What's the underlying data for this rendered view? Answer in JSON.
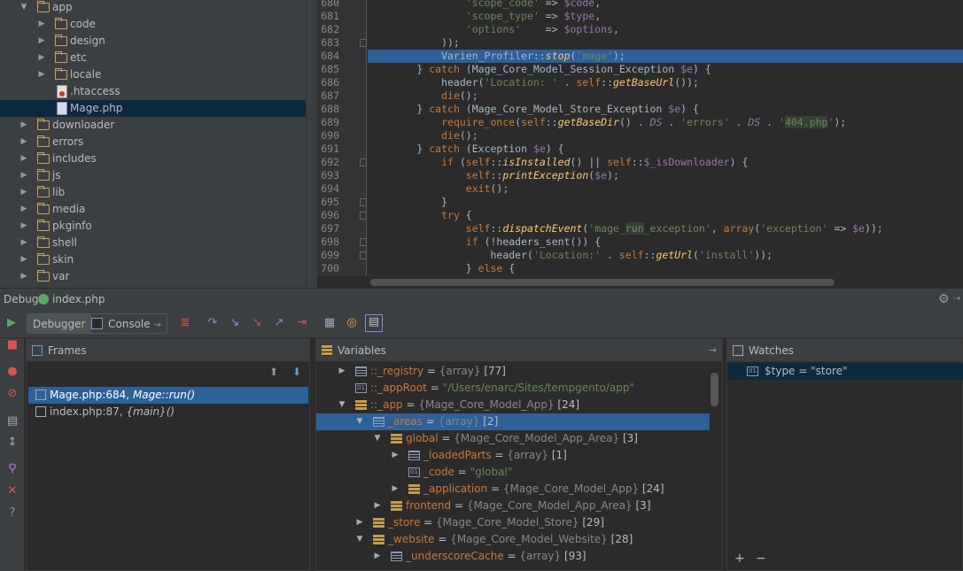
{
  "tree": {
    "items": [
      {
        "label": "app",
        "icon": "folder-icon",
        "expanded": true
      },
      {
        "label": "code",
        "icon": "folder-icon",
        "expanded": false
      },
      {
        "label": "design",
        "icon": "folder-icon",
        "expanded": false
      },
      {
        "label": "etc",
        "icon": "folder-icon",
        "expanded": false
      },
      {
        "label": "locale",
        "icon": "folder-icon",
        "expanded": false
      },
      {
        "label": ".htaccess",
        "icon": "file-icon"
      },
      {
        "label": "Mage.php",
        "icon": "php-file-icon",
        "selected": true
      },
      {
        "label": "downloader",
        "icon": "folder-icon",
        "expanded": false
      },
      {
        "label": "errors",
        "icon": "folder-icon",
        "expanded": false
      },
      {
        "label": "includes",
        "icon": "folder-icon",
        "expanded": false
      },
      {
        "label": "js",
        "icon": "folder-icon",
        "expanded": false
      },
      {
        "label": "lib",
        "icon": "folder-icon",
        "expanded": false
      },
      {
        "label": "media",
        "icon": "folder-icon",
        "expanded": false
      },
      {
        "label": "pkginfo",
        "icon": "folder-icon",
        "expanded": false
      },
      {
        "label": "shell",
        "icon": "folder-icon",
        "expanded": false
      },
      {
        "label": "skin",
        "icon": "folder-icon",
        "expanded": false
      },
      {
        "label": "var",
        "icon": "folder-icon",
        "expanded": false
      }
    ]
  },
  "editor": {
    "lines": [
      {
        "n": "680",
        "t": "                'scope_code' => $code,"
      },
      {
        "n": "681",
        "t": "                'scope_type' => $type,"
      },
      {
        "n": "682",
        "t": "                'options'    => $options,"
      },
      {
        "n": "683",
        "t": "            ));"
      },
      {
        "n": "684",
        "t": "            Varien_Profiler::stop('mage');",
        "highlight": true
      },
      {
        "n": "685",
        "t": "        } catch (Mage_Core_Model_Session_Exception $e) {"
      },
      {
        "n": "686",
        "t": "            header('Location: ' . self::getBaseUrl());"
      },
      {
        "n": "687",
        "t": "            die();"
      },
      {
        "n": "688",
        "t": "        } catch (Mage_Core_Model_Store_Exception $e) {"
      },
      {
        "n": "689",
        "t": "            require_once(self::getBaseDir() . DS . 'errors' . DS . '404.php');"
      },
      {
        "n": "690",
        "t": "            die();"
      },
      {
        "n": "691",
        "t": "        } catch (Exception $e) {"
      },
      {
        "n": "692",
        "t": "            if (self::isInstalled() || self::$_isDownloader) {"
      },
      {
        "n": "693",
        "t": "                self::printException($e);"
      },
      {
        "n": "694",
        "t": "                exit();"
      },
      {
        "n": "695",
        "t": "            }"
      },
      {
        "n": "696",
        "t": "            try {"
      },
      {
        "n": "697",
        "t": "                self::dispatchEvent('mage_run_exception', array('exception' => $e));"
      },
      {
        "n": "698",
        "t": "                if (!headers_sent()) {"
      },
      {
        "n": "699",
        "t": "                    header('Location:' . self::getUrl('install'));"
      },
      {
        "n": "700",
        "t": "                } else {"
      }
    ]
  },
  "debug": {
    "title": "Debug",
    "config": "index.php",
    "tabs": [
      {
        "label": "Debugger"
      },
      {
        "label": "Console"
      }
    ],
    "frames_title": "Frames",
    "frames": [
      {
        "file": "Mage.php:684, ",
        "fn": "Mage::run()",
        "selected": true
      },
      {
        "file": "index.php:87, ",
        "fn": "{main}()"
      }
    ],
    "variables_title": "Variables",
    "variables": [
      {
        "level": 0,
        "arrow": "right",
        "icon": "array",
        "name": "::_registry",
        "eq": " = ",
        "type": "{array}",
        "extra": " [77]"
      },
      {
        "level": 0,
        "arrow": "",
        "icon": "string",
        "name": "::_appRoot",
        "eq": " = ",
        "str": "\"/Users/enarc/Sites/tempgento/app\""
      },
      {
        "level": 0,
        "arrow": "down",
        "icon": "object",
        "name": "::_app",
        "eq": " = ",
        "type": "{Mage_Core_Model_App}",
        "extra": " [24]"
      },
      {
        "level": 1,
        "arrow": "down",
        "icon": "array",
        "name": "_areas",
        "eq": " = ",
        "type": "{array}",
        "extra": " [2]",
        "selected": true
      },
      {
        "level": 2,
        "arrow": "down",
        "icon": "object",
        "name": "global",
        "eq": " = ",
        "type": "{Mage_Core_Model_App_Area}",
        "extra": " [3]"
      },
      {
        "level": 3,
        "arrow": "right",
        "icon": "array",
        "name": "_loadedParts",
        "eq": " = ",
        "type": "{array}",
        "extra": " [1]"
      },
      {
        "level": 3,
        "arrow": "",
        "icon": "string",
        "name": "_code",
        "eq": " = ",
        "str": "\"global\""
      },
      {
        "level": 3,
        "arrow": "right",
        "icon": "object",
        "name": "_application",
        "eq": " = ",
        "type": "{Mage_Core_Model_App}",
        "extra": " [24]"
      },
      {
        "level": 2,
        "arrow": "right",
        "icon": "object",
        "name": "frontend",
        "eq": " = ",
        "type": "{Mage_Core_Model_App_Area}",
        "extra": " [3]"
      },
      {
        "level": 1,
        "arrow": "right",
        "icon": "object",
        "name": "_store",
        "eq": " = ",
        "type": "{Mage_Core_Model_Store}",
        "extra": " [29]"
      },
      {
        "level": 1,
        "arrow": "down",
        "icon": "object",
        "name": "_website",
        "eq": " = ",
        "type": "{Mage_Core_Model_Website}",
        "extra": " [28]"
      },
      {
        "level": 2,
        "arrow": "right",
        "icon": "array",
        "name": "_underscoreCache",
        "eq": " = ",
        "type": "{array}",
        "extra": " [93]"
      }
    ],
    "watches_title": "Watches",
    "watches": [
      {
        "text": "$type = \"store\""
      }
    ],
    "watch_add": "+",
    "watch_remove": "−"
  },
  "colors": {
    "selection": "#2d6099",
    "background": "#2b2b2b",
    "panel": "#3c3f41"
  }
}
